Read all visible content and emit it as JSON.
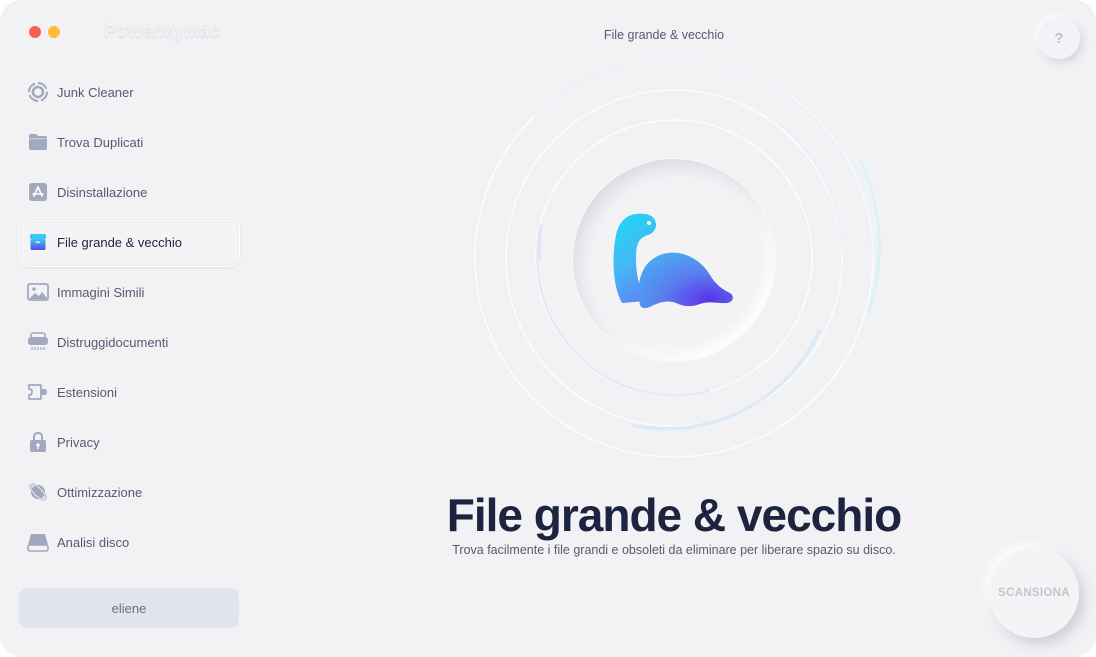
{
  "app": {
    "title": "PowerMyMac",
    "window_controls": [
      "close",
      "minimize"
    ]
  },
  "header": {
    "title": "File grande & vecchio",
    "help_label": "?"
  },
  "sidebar": {
    "items": [
      {
        "label": "Junk Cleaner",
        "icon": "junk-cleaner-icon",
        "active": false
      },
      {
        "label": "Trova Duplicati",
        "icon": "folder-icon",
        "active": false
      },
      {
        "label": "Disinstallazione",
        "icon": "app-store-icon",
        "active": false
      },
      {
        "label": "File grande & vecchio",
        "icon": "archive-box-icon",
        "active": true
      },
      {
        "label": "Immagini Simili",
        "icon": "image-icon",
        "active": false
      },
      {
        "label": "Distruggidocumenti",
        "icon": "shredder-icon",
        "active": false
      },
      {
        "label": "Estensioni",
        "icon": "plugin-icon",
        "active": false
      },
      {
        "label": "Privacy",
        "icon": "lock-icon",
        "active": false
      },
      {
        "label": "Ottimizzazione",
        "icon": "planet-icon",
        "active": false
      },
      {
        "label": "Analisi disco",
        "icon": "disk-icon",
        "active": false
      }
    ],
    "user_label": "eliene"
  },
  "main": {
    "hero_title": "File grande & vecchio",
    "hero_subtitle": "Trova facilmente i file grandi e obsoleti da eliminare per liberare spazio su disco.",
    "scan_button_label": "SCANSIONA",
    "mascot": "dinosaur-logo"
  },
  "colors": {
    "background": "#f2f2f5",
    "text_dark": "#1e2340",
    "text_muted": "#545a72",
    "icon_gray": "#a3a8be",
    "accent_cyan": "#22d3ee",
    "accent_purple": "#5b3df0"
  }
}
